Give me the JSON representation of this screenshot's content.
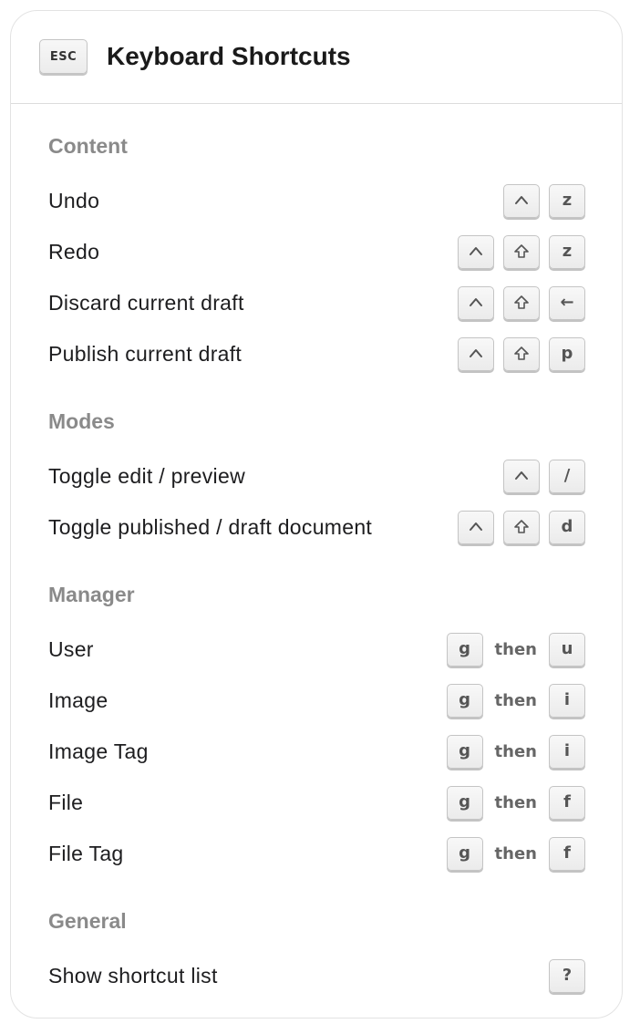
{
  "header": {
    "esc_label": "ESC",
    "title": "Keyboard Shortcuts"
  },
  "sections": [
    {
      "title": "Content",
      "rows": [
        {
          "label": "Undo",
          "keys": [
            "ctrl",
            "z"
          ]
        },
        {
          "label": "Redo",
          "keys": [
            "ctrl",
            "shift",
            "z"
          ]
        },
        {
          "label": "Discard current draft",
          "keys": [
            "ctrl",
            "shift",
            "←"
          ]
        },
        {
          "label": "Publish current draft",
          "keys": [
            "ctrl",
            "shift",
            "p"
          ]
        }
      ]
    },
    {
      "title": "Modes",
      "rows": [
        {
          "label": "Toggle edit / preview",
          "keys": [
            "ctrl",
            "/"
          ]
        },
        {
          "label": "Toggle published / draft document",
          "keys": [
            "ctrl",
            "shift",
            "d"
          ]
        }
      ]
    },
    {
      "title": "Manager",
      "rows": [
        {
          "label": "User",
          "keys": [
            "g",
            "then",
            "u"
          ]
        },
        {
          "label": "Image",
          "keys": [
            "g",
            "then",
            "i"
          ]
        },
        {
          "label": "Image Tag",
          "keys": [
            "g",
            "then",
            "i"
          ]
        },
        {
          "label": "File",
          "keys": [
            "g",
            "then",
            "f"
          ]
        },
        {
          "label": "File Tag",
          "keys": [
            "g",
            "then",
            "f"
          ]
        }
      ]
    },
    {
      "title": "General",
      "rows": [
        {
          "label": "Show shortcut list",
          "keys": [
            "?"
          ]
        }
      ]
    }
  ],
  "icons": {
    "ctrl": "control-caret-icon",
    "shift": "shift-arrow-icon"
  }
}
